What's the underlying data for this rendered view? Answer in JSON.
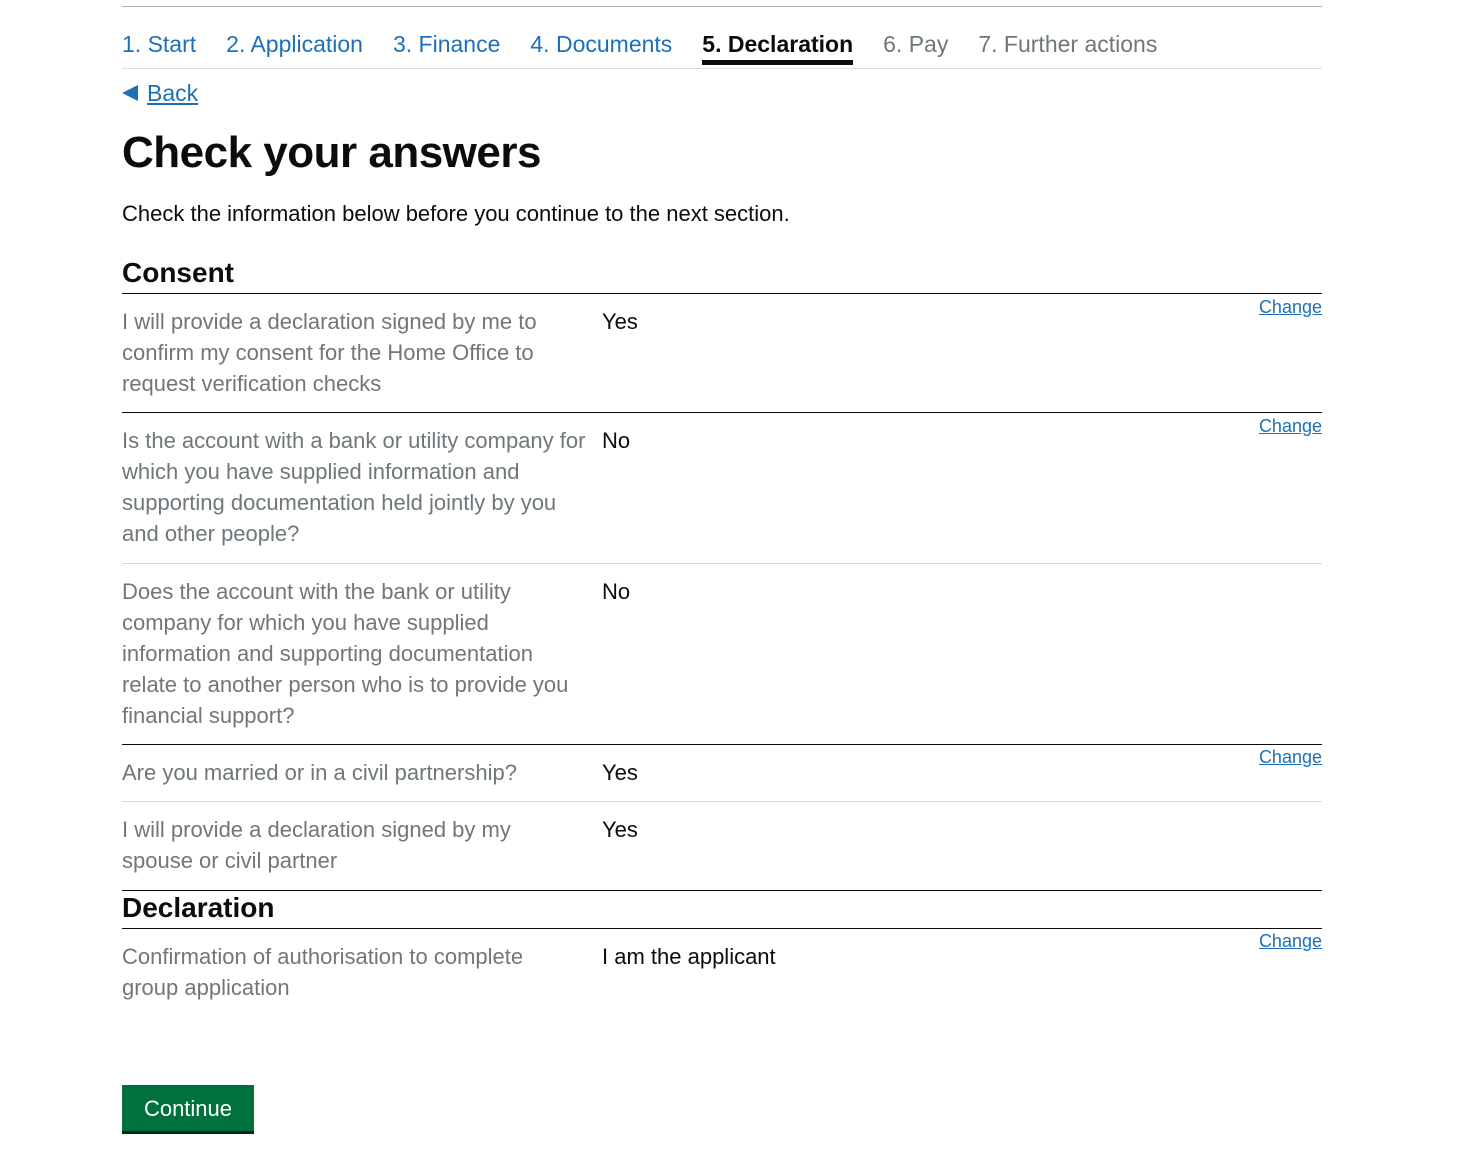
{
  "steps": [
    {
      "label": "1. Start",
      "state": "done"
    },
    {
      "label": "2. Application",
      "state": "done"
    },
    {
      "label": "3. Finance",
      "state": "done"
    },
    {
      "label": "4. Documents",
      "state": "done"
    },
    {
      "label": "5. Declaration",
      "state": "current"
    },
    {
      "label": "6. Pay",
      "state": "future"
    },
    {
      "label": "7. Further actions",
      "state": "future"
    }
  ],
  "back_label": "Back",
  "page_title": "Check your answers",
  "intro": "Check the information below before you continue to the next section.",
  "sections": {
    "consent": {
      "heading": "Consent",
      "rows": [
        {
          "key": "I will provide a declaration signed by me to confirm my consent for the Home Office to request verification checks",
          "value": "Yes",
          "action": "Change"
        },
        {
          "key": "Is the account with a bank or utility company for which you have supplied information and supporting documentation held jointly by you and other people?",
          "value": "No",
          "action": "Change"
        },
        {
          "key": "Does the account with the bank or utility company for which you have supplied information and supporting documentation relate to another person who is to provide you financial support?",
          "value": "No"
        },
        {
          "key": "Are you married or in a civil partnership?",
          "value": "Yes",
          "action": "Change"
        },
        {
          "key": "I will provide a declaration signed by my spouse or civil partner",
          "value": "Yes"
        }
      ]
    },
    "declaration": {
      "heading": "Declaration",
      "rows": [
        {
          "key": "Confirmation of authorisation to complete group application",
          "value": "I am the applicant",
          "action": "Change"
        }
      ]
    }
  },
  "continue_label": "Continue",
  "colors": {
    "link": "#1d70b8",
    "text": "#0b0c0c",
    "secondary_text": "#6f777b",
    "button": "#00703c"
  }
}
